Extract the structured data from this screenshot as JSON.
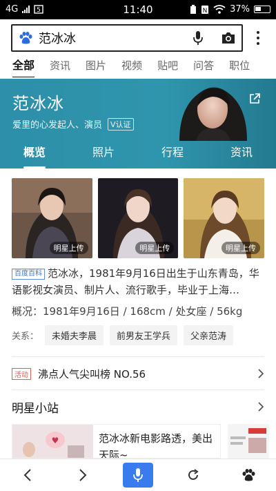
{
  "status_bar": {
    "network": "4G",
    "time": "11:40",
    "battery": "37%"
  },
  "search": {
    "query": "范冰冰"
  },
  "category_tabs": [
    "全部",
    "资讯",
    "图片",
    "视频",
    "贴吧",
    "问答",
    "职位"
  ],
  "hero": {
    "name": "范冰冰",
    "description": "爱里的心发起人、演员",
    "verified": "V认证",
    "tabs": [
      "概览",
      "照片",
      "行程",
      "资讯"
    ]
  },
  "photos": [
    {
      "tag": "明星上传"
    },
    {
      "tag": "明星上传"
    },
    {
      "tag": "明星上传"
    }
  ],
  "intro": {
    "source": "百度百科",
    "text": "范冰冰，1981年9月16日出生于山东青岛，华语影视女演员、制片人、流行歌手，毕业于上海…",
    "facts": "概况：1981年9月16日 / 168cm / 处女座 / 56kg"
  },
  "relations": {
    "label": "关系：",
    "items": [
      "未婚夫李晨",
      "前男友王学兵",
      "父亲范涛"
    ]
  },
  "event": {
    "badge": "活动",
    "text": "沸点人气尖叫榜 NO.56"
  },
  "section": {
    "title": "明星小站"
  },
  "card": {
    "title": "范冰冰新电影路透，美出天际~"
  },
  "colors": {
    "hero_bg": "#2f95ad",
    "accent_blue": "#3a7cf0",
    "event_red": "#e05a4e"
  }
}
